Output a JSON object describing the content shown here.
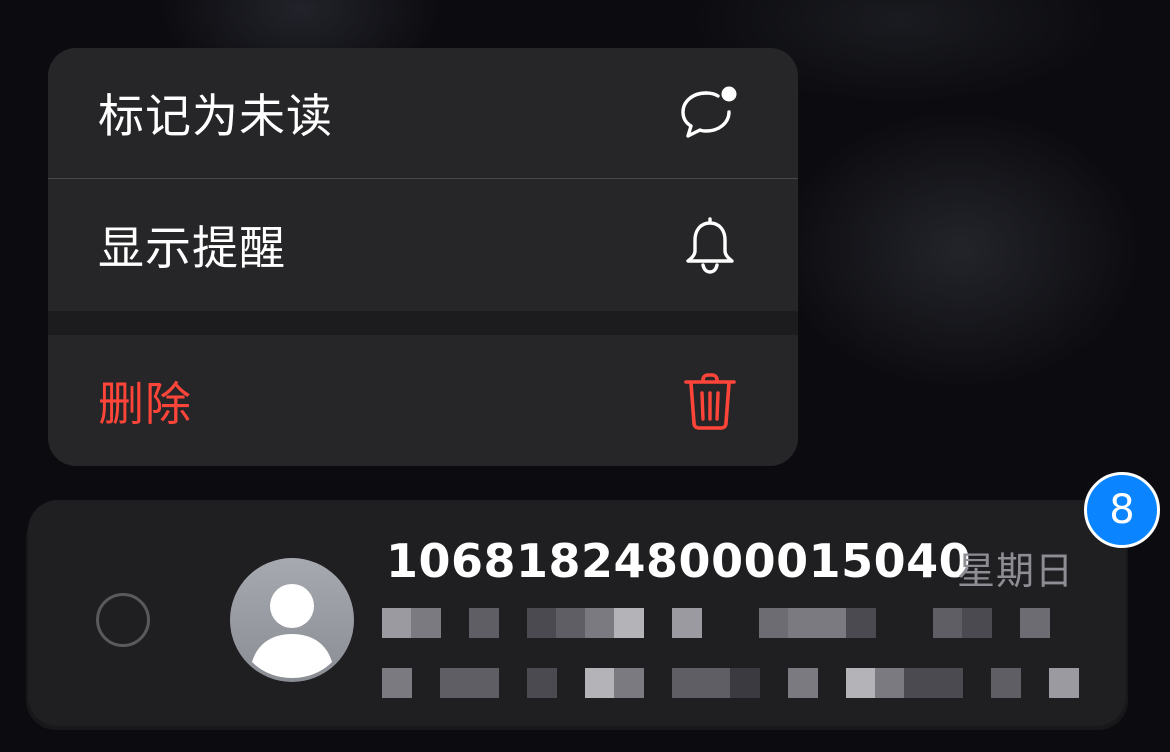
{
  "context_menu": {
    "items": [
      {
        "label": "标记为未读",
        "icon": "chat-bubble-dot-icon"
      },
      {
        "label": "显示提醒",
        "icon": "bell-icon"
      },
      {
        "label": "删除",
        "icon": "trash-icon"
      }
    ],
    "destructive_color": "#ff453a"
  },
  "conversation": {
    "sender": "106818248000015040",
    "date": "星期日",
    "unread_badge": "8",
    "badge_color": "#0a84ff",
    "avatar_icon": "person-silhouette-icon",
    "preview_icon": "pixelated-preview-icon"
  }
}
